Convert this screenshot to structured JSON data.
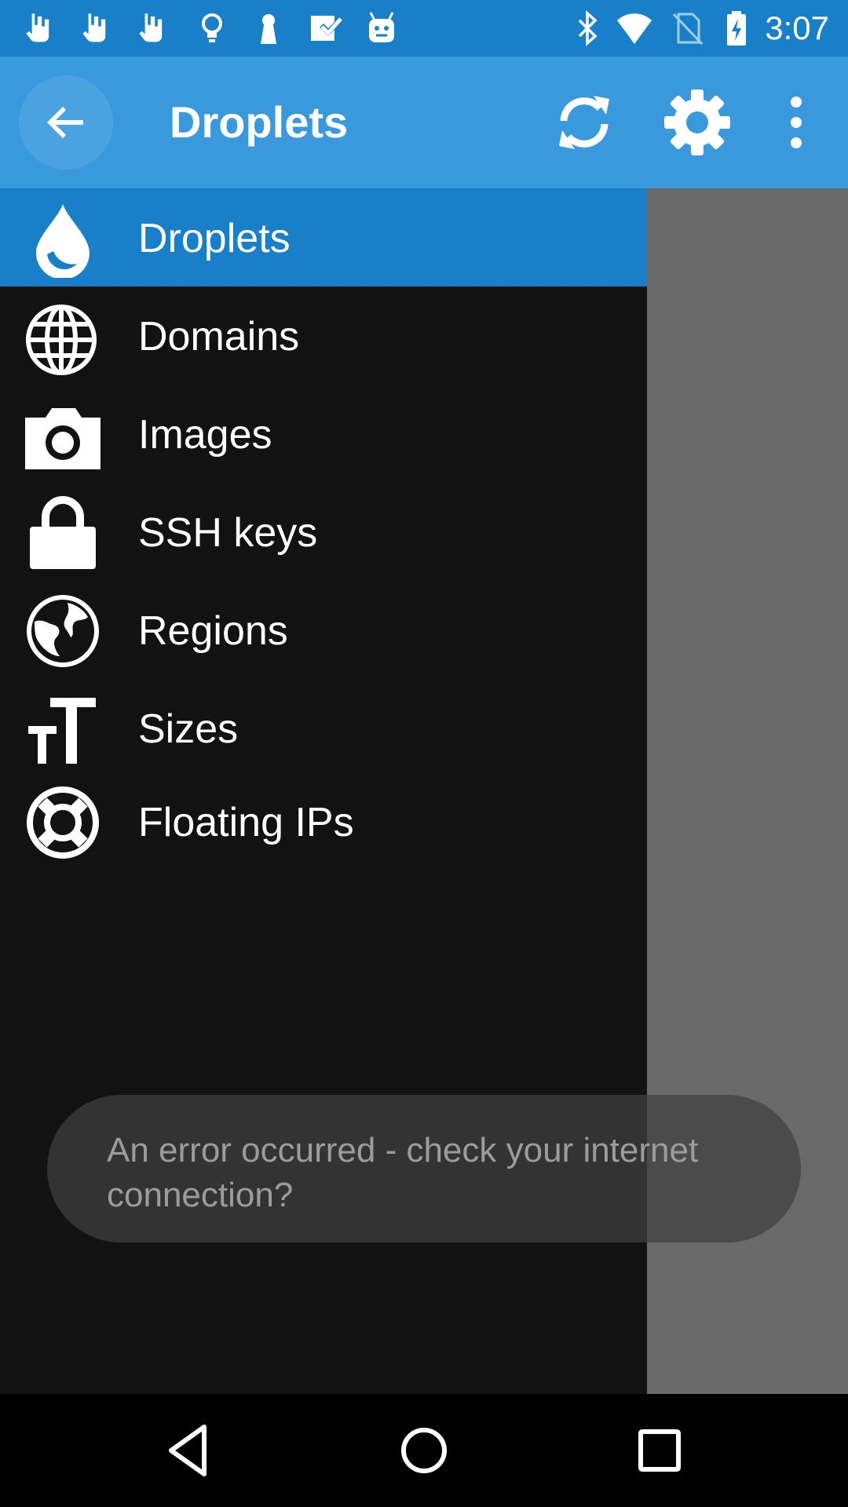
{
  "status_bar": {
    "time": "3:07",
    "icons": [
      "hand-icon",
      "hand-icon",
      "hand-icon",
      "lightbulb-icon",
      "keyhole-icon",
      "checkbox-icon",
      "android-icon",
      "bluetooth-icon",
      "wifi-icon",
      "no-sim-icon",
      "battery-charging-icon"
    ]
  },
  "app_bar": {
    "title": "Droplets",
    "actions": [
      "refresh-icon",
      "settings-icon",
      "overflow-menu-icon"
    ]
  },
  "drawer": {
    "items": [
      {
        "label": "Droplets",
        "icon": "droplet-icon",
        "active": true
      },
      {
        "label": "Domains",
        "icon": "globe-grid-icon",
        "active": false
      },
      {
        "label": "Images",
        "icon": "camera-icon",
        "active": false
      },
      {
        "label": "SSH keys",
        "icon": "lock-icon",
        "active": false
      },
      {
        "label": "Regions",
        "icon": "earth-icon",
        "active": false
      },
      {
        "label": "Sizes",
        "icon": "text-size-icon",
        "active": false
      },
      {
        "label": "Floating IPs",
        "icon": "life-ring-icon",
        "active": false
      }
    ]
  },
  "toast": {
    "message": "An error occurred - check your internet connection?"
  },
  "colors": {
    "status_bar": "#1a7fc9",
    "app_bar": "#3a99dd",
    "active_item": "#1a7fc9",
    "drawer_bg": "#121212",
    "scrim": "#6a6a6a"
  }
}
